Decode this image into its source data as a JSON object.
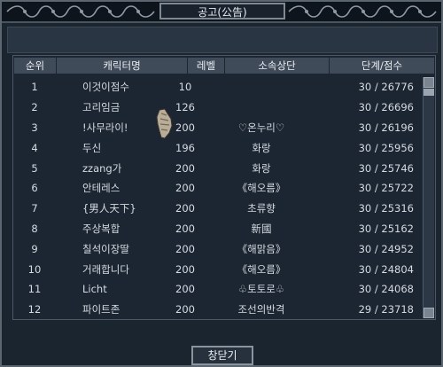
{
  "window": {
    "title": "공고(公告)"
  },
  "table": {
    "headers": [
      "순위",
      "캐릭터명",
      "레벨",
      "소속상단",
      "단계/점수"
    ],
    "rows": [
      {
        "rank": "1",
        "name": "이것이점수",
        "level": "10",
        "guild": "",
        "score": "30 / 26776"
      },
      {
        "rank": "2",
        "name": "고리임금",
        "level": "126",
        "guild": "",
        "score": "30 / 26696"
      },
      {
        "rank": "3",
        "name": "!사무라이!",
        "level": "200",
        "guild": "♡온누리♡",
        "score": "30 / 26196"
      },
      {
        "rank": "4",
        "name": "두신",
        "level": "196",
        "guild": "화랑",
        "score": "30 / 25956"
      },
      {
        "rank": "5",
        "name": "zzang가",
        "level": "200",
        "guild": "화랑",
        "score": "30 / 25746"
      },
      {
        "rank": "6",
        "name": "안테레스",
        "level": "200",
        "guild": "《해오름》",
        "score": "30 / 25722"
      },
      {
        "rank": "7",
        "name": "{男人天下}",
        "level": "200",
        "guild": "초류향",
        "score": "30 / 25316"
      },
      {
        "rank": "8",
        "name": "주상복합",
        "level": "200",
        "guild": "新國",
        "score": "30 / 25162"
      },
      {
        "rank": "9",
        "name": "칠석이장딸",
        "level": "200",
        "guild": "《해맑음》",
        "score": "30 / 24952"
      },
      {
        "rank": "10",
        "name": "거래합니다",
        "level": "200",
        "guild": "《해오름》",
        "score": "30 / 24804"
      },
      {
        "rank": "11",
        "name": "Licht",
        "level": "200",
        "guild": "♧토토로♧",
        "score": "30 / 24068"
      },
      {
        "rank": "12",
        "name": "파이트존",
        "level": "200",
        "guild": "조선의반격",
        "score": "29 / 23718"
      }
    ]
  },
  "footer": {
    "close_label": "창닫기"
  },
  "colors": {
    "background": "#1b2530",
    "header_bg": "#3f4b59",
    "text": "#d5dbe2",
    "frame": "#7e8993"
  }
}
